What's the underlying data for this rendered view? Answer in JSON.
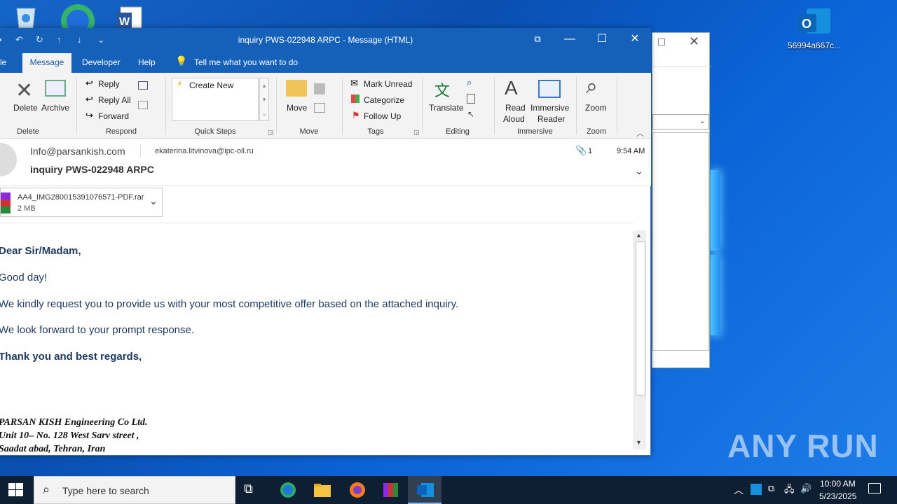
{
  "desktop": {
    "outlook_icon_label": "56994a667c..."
  },
  "window": {
    "title": "inquiry PWS-022948 ARPC  -  Message (HTML)",
    "tabs": [
      "le",
      "Message",
      "Developer",
      "Help"
    ],
    "tell_me": "Tell me what you want to do"
  },
  "ribbon": {
    "delete": "Delete",
    "archive": "Archive",
    "group_delete": "Delete",
    "reply": "Reply",
    "reply_all": "Reply All",
    "forward": "Forward",
    "group_respond": "Respond",
    "create_new": "Create New",
    "group_quick_steps": "Quick Steps",
    "move": "Move",
    "group_move": "Move",
    "mark_unread": "Mark Unread",
    "categorize": "Categorize",
    "follow_up": "Follow Up",
    "group_tags": "Tags",
    "translate": "Translate",
    "group_editing": "Editing",
    "read_aloud_1": "Read",
    "read_aloud_2": "Aloud",
    "immersive_1": "Immersive",
    "immersive_2": "Reader",
    "group_immersive": "Immersive",
    "zoom": "Zoom",
    "group_zoom": "Zoom"
  },
  "message": {
    "from": "Info@parsankish.com",
    "to": "ekaterina.litvinova@ipc-oil.ru",
    "subject": "inquiry PWS-022948 ARPC",
    "attachment_count": "1",
    "time": "9:54 AM",
    "attachment_name": "AA4_IMG280015391076571-PDF.rar",
    "attachment_size": "2 MB"
  },
  "body": {
    "greeting": "Dear Sir/Madam,",
    "line1": "Good day!",
    "line2": "We kindly request you to provide us with your most competitive offer based on the attached inquiry.",
    "line3": "We look forward to your prompt response.",
    "closing": "Thank you and best regards,",
    "sig1": "PARSAN KISH Engineering Co Ltd.",
    "sig2": "Unit 10– No. 128  West Sarv street ,",
    "sig3": "Saadat abad, Tehran, Iran"
  },
  "taskbar": {
    "search_placeholder": "Type here to search",
    "time": "10:00 AM",
    "date": "5/23/2025"
  },
  "watermark": "ANY RUN"
}
